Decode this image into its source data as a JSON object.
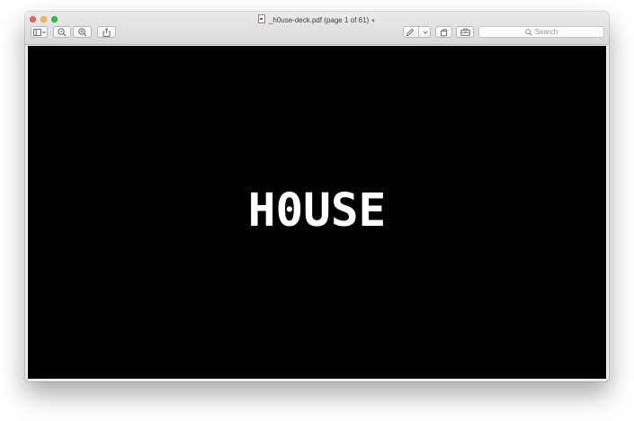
{
  "window": {
    "title": "_h0use-deck.pdf (page 1 of 61)"
  },
  "toolbar": {
    "search_placeholder": "Search",
    "icons": [
      "sidebar-icon",
      "zoom-out-icon",
      "zoom-in-icon",
      "share-icon",
      "markup-pen-icon",
      "rotate-icon",
      "toolbox-icon",
      "search-icon"
    ]
  },
  "document": {
    "page_text": "H0USE",
    "current_page": 1,
    "total_pages": 61,
    "background_color": "#000000",
    "text_color": "#ffffff"
  },
  "colors": {
    "close": "#fc5f57",
    "minimize": "#fdbc2e",
    "maximize": "#28c840"
  }
}
